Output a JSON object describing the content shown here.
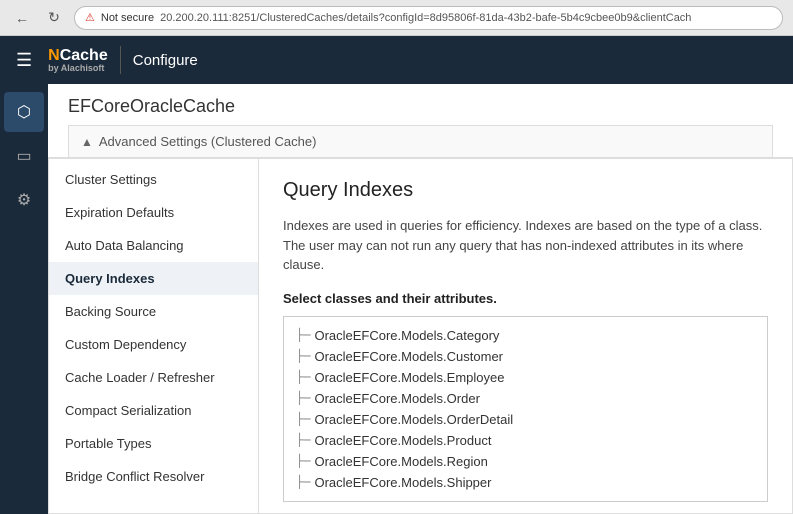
{
  "browser": {
    "back_label": "←",
    "reload_label": "↻",
    "not_secure": "Not secure",
    "address": "20.200.20.111:8251/ClusteredCaches/details?configId=8d95806f-81da-43b2-bafe-5b4c9cbee0b9&clientCach"
  },
  "header": {
    "menu_icon": "☰",
    "logo_n": "N",
    "logo_rest": "Cache",
    "logo_sub": "by Alachisoft",
    "configure_label": "Configure"
  },
  "sidebar_icons": [
    {
      "name": "topology-icon",
      "symbol": "⬡"
    },
    {
      "name": "monitor-icon",
      "symbol": "▭"
    },
    {
      "name": "tools-icon",
      "symbol": "⚙"
    }
  ],
  "page": {
    "title": "EFCoreOracleCache",
    "advanced_settings": "Advanced Settings (Clustered Cache)",
    "collapse_symbol": "▲"
  },
  "left_nav": {
    "items": [
      {
        "id": "cluster-settings",
        "label": "Cluster Settings"
      },
      {
        "id": "expiration-defaults",
        "label": "Expiration Defaults"
      },
      {
        "id": "auto-data-balancing",
        "label": "Auto Data Balancing"
      },
      {
        "id": "query-indexes",
        "label": "Query Indexes",
        "active": true
      },
      {
        "id": "backing-source",
        "label": "Backing Source"
      },
      {
        "id": "custom-dependency",
        "label": "Custom Dependency"
      },
      {
        "id": "cache-loader",
        "label": "Cache Loader / Refresher"
      },
      {
        "id": "compact-serialization",
        "label": "Compact Serialization"
      },
      {
        "id": "portable-types",
        "label": "Portable Types"
      },
      {
        "id": "bridge-conflict",
        "label": "Bridge Conflict Resolver"
      }
    ]
  },
  "query_indexes": {
    "title": "Query Indexes",
    "description": "Indexes are used in queries for efficiency. Indexes are based on the type of a class. The user may can not run any query that has non-indexed attributes in its where clause.",
    "select_label": "Select classes and their attributes.",
    "classes": [
      "OracleEFCore.Models.Category",
      "OracleEFCore.Models.Customer",
      "OracleEFCore.Models.Employee",
      "OracleEFCore.Models.Order",
      "OracleEFCore.Models.OrderDetail",
      "OracleEFCore.Models.Product",
      "OracleEFCore.Models.Region",
      "OracleEFCore.Models.Shipper"
    ]
  }
}
